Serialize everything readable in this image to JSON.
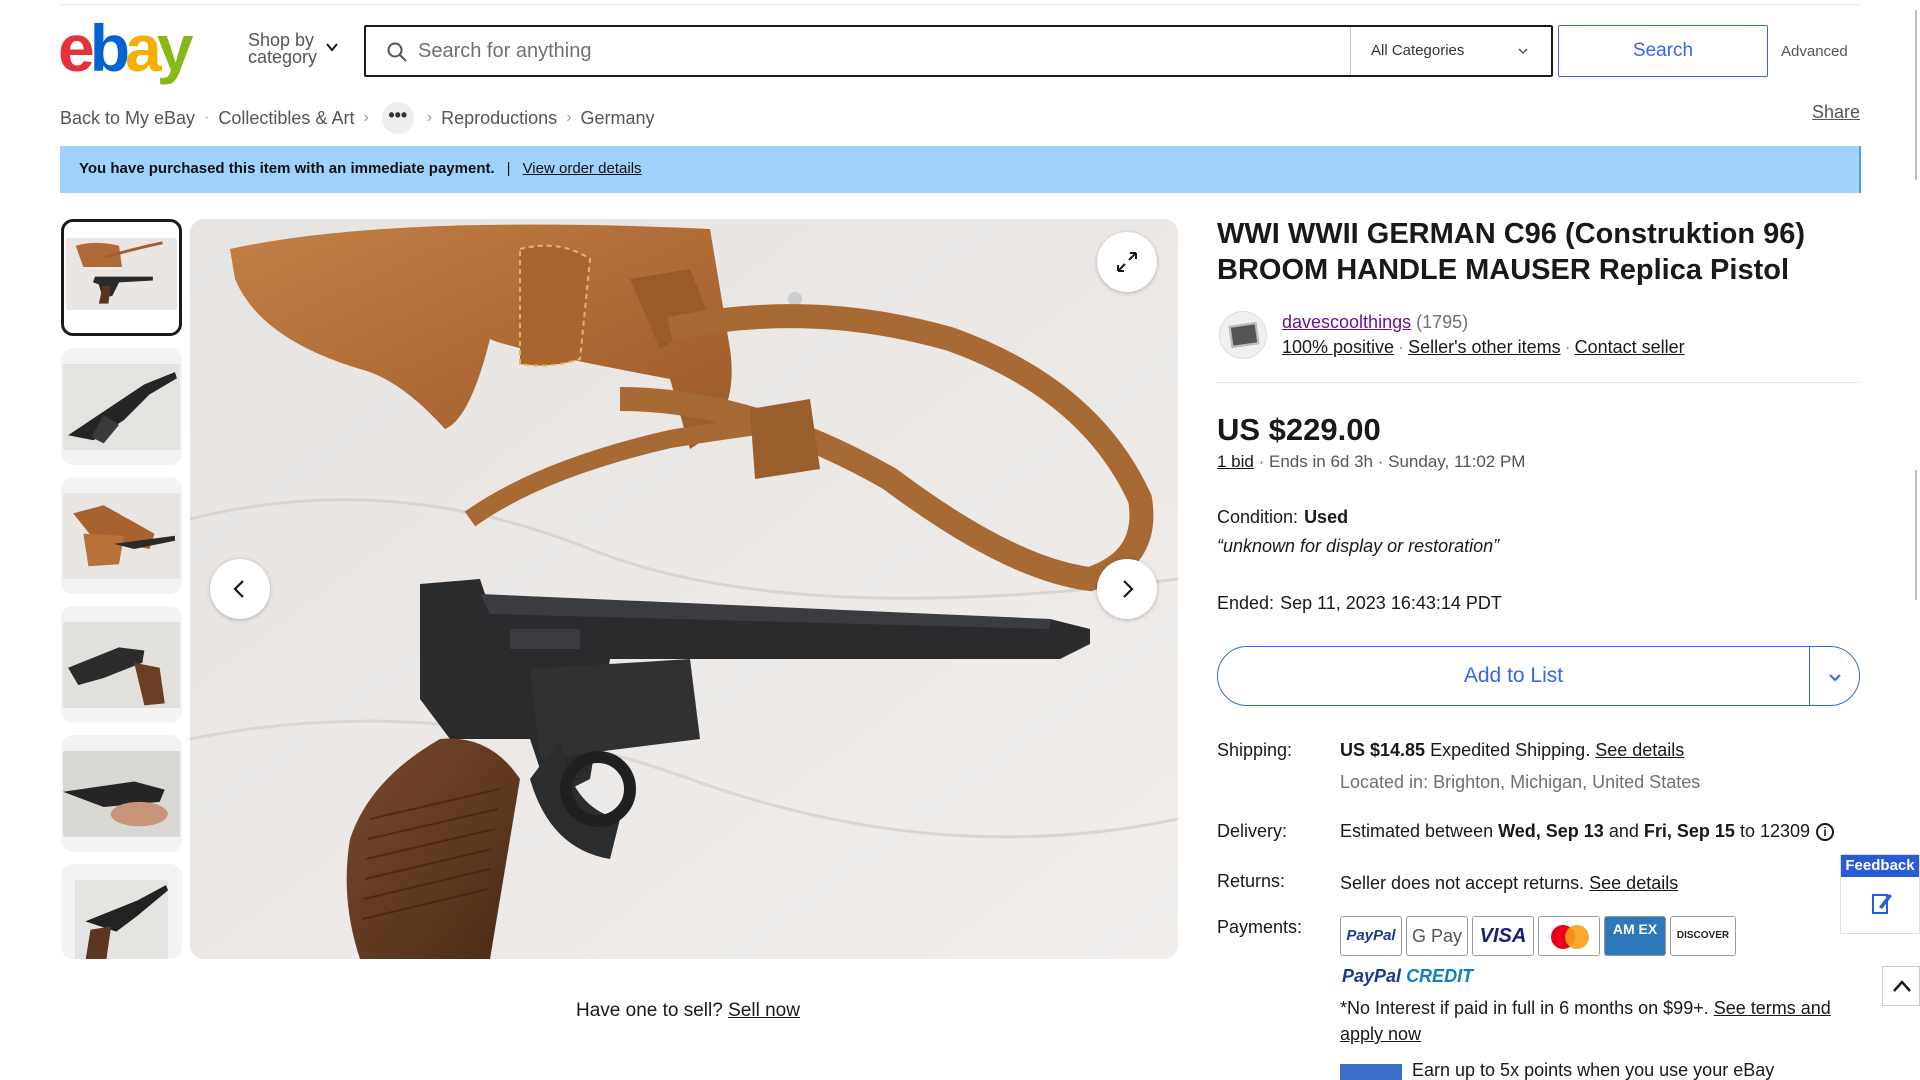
{
  "header": {
    "logo_letters": [
      {
        "ch": "e",
        "color": "#e53238"
      },
      {
        "ch": "b",
        "color": "#0064d2"
      },
      {
        "ch": "a",
        "color": "#f5af02"
      },
      {
        "ch": "y",
        "color": "#86b817"
      }
    ],
    "shop_by_line1": "Shop by",
    "shop_by_line2": "category",
    "search_placeholder": "Search for anything",
    "category_selected": "All Categories",
    "search_button": "Search",
    "advanced_link": "Advanced"
  },
  "breadcrumb": {
    "items": [
      "Back to My eBay",
      "Collectibles & Art",
      "Reproductions",
      "Germany"
    ],
    "more": "•••",
    "share": "Share"
  },
  "banner": {
    "message": "You have purchased this item with an immediate payment.",
    "separator": "|",
    "link": "View order details"
  },
  "listing": {
    "title": "WWI WWII GERMAN C96 (Construktion 96) BROOM HANDLE MAUSER Replica Pistol",
    "seller": {
      "name": "davescoolthings",
      "feedback_count": "(1795)",
      "positive": "100% positive",
      "other_items": "Seller's other items",
      "contact": "Contact seller"
    },
    "price": "US $229.00",
    "bids": "1 bid",
    "ends": "Ends in 6d 3h",
    "end_time": "Sunday, 11:02 PM",
    "condition_label": "Condition:",
    "condition_value": "Used",
    "condition_note": "“unknown for display or restoration”",
    "ended_label": "Ended:",
    "ended_value": "Sep 11, 2023 16:43:14 PDT",
    "add_to_list": "Add to List"
  },
  "shipping": {
    "label": "Shipping:",
    "cost": "US $14.85",
    "method": "Expedited Shipping.",
    "details_link": "See details",
    "location": "Located in: Brighton, Michigan, United States"
  },
  "delivery": {
    "label": "Delivery:",
    "prefix": "Estimated between",
    "date_from": "Wed, Sep 13",
    "and": "and",
    "date_to": "Fri, Sep 15",
    "to_zip": "to 12309",
    "info": "i"
  },
  "returns": {
    "label": "Returns:",
    "text": "Seller does not accept returns.",
    "details_link": "See details"
  },
  "payments": {
    "label": "Payments:",
    "methods": [
      "PayPal",
      "G Pay",
      "VISA",
      "Mastercard",
      "AM EX",
      "DISCOVER"
    ],
    "paypal_credit_a": "PayPal",
    "paypal_credit_b": "CREDIT",
    "no_interest": "*No Interest if paid in full in 6 months on $99+.",
    "terms_link": "See terms and apply now",
    "earn_points": "Earn up to 5x points when you use your eBay"
  },
  "sell": {
    "question": "Have one to sell?",
    "link": "Sell now"
  },
  "widgets": {
    "feedback": "Feedback"
  },
  "colors": {
    "accent": "#3665f3",
    "banner": "#9fd2fc",
    "seller_link": "#6b0f9b"
  }
}
